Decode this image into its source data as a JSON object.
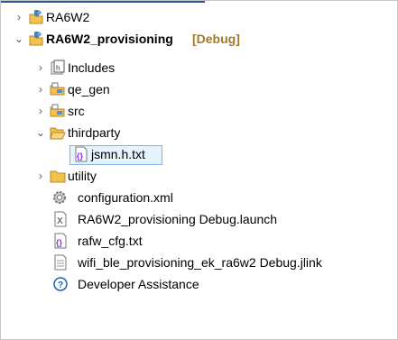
{
  "tree": {
    "items": [
      {
        "label": "RA6W2",
        "decoration": "",
        "icon": "project-icon",
        "expand": ">"
      },
      {
        "label": "RA6W2_provisioning",
        "decoration": "[Debug]",
        "icon": "project-icon",
        "expand": "v"
      },
      {
        "label": "Includes",
        "icon": "includes-folder-icon",
        "expand": ">"
      },
      {
        "label": "qe_gen",
        "icon": "source-folder-icon",
        "expand": ">"
      },
      {
        "label": "src",
        "icon": "source-folder-icon",
        "expand": ">"
      },
      {
        "label": "thirdparty",
        "icon": "open-folder-icon",
        "expand": "v"
      },
      {
        "label": "jsmn.h.txt",
        "icon": "text-file-icon"
      },
      {
        "label": "utility",
        "icon": "folder-icon",
        "expand": ">"
      },
      {
        "label": "configuration.xml",
        "icon": "configuration-gear-icon"
      },
      {
        "label": "RA6W2_provisioning Debug.launch",
        "icon": "launch-file-icon"
      },
      {
        "label": "rafw_cfg.txt",
        "icon": "text-file-icon"
      },
      {
        "label": "wifi_ble_provisioning_ek_ra6w2 Debug.jlink",
        "icon": "document-icon"
      },
      {
        "label": "Developer Assistance",
        "icon": "help-icon"
      }
    ]
  }
}
